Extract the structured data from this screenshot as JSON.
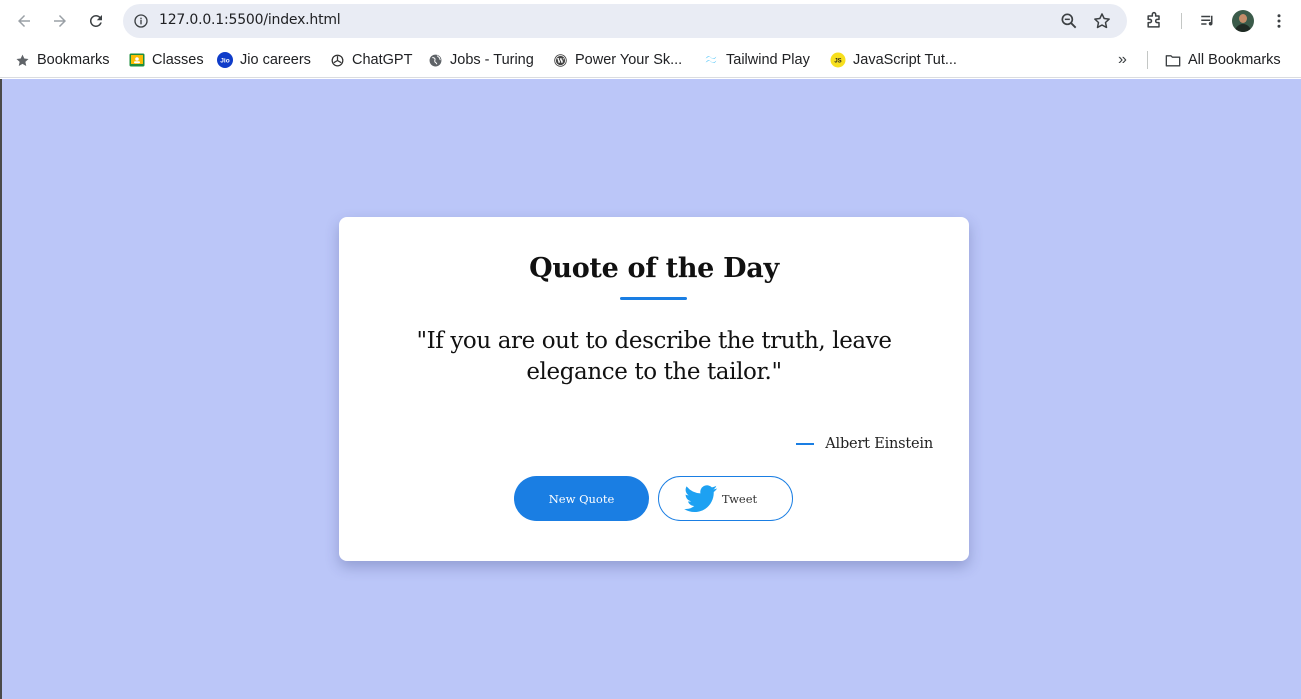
{
  "browser": {
    "url": "127.0.0.1:5500/index.html"
  },
  "bookmarks": {
    "items": [
      {
        "label": "Bookmarks",
        "icon": "star-icon"
      },
      {
        "label": "Classes",
        "icon": "classroom-icon"
      },
      {
        "label": "Jio careers",
        "icon": "jio-icon"
      },
      {
        "label": "ChatGPT",
        "icon": "openai-icon"
      },
      {
        "label": "Jobs - Turing",
        "icon": "globe-icon"
      },
      {
        "label": "Power Your Sk...",
        "icon": "wordpress-icon"
      },
      {
        "label": "Tailwind Play",
        "icon": "tailwind-icon"
      },
      {
        "label": "JavaScript Tut...",
        "icon": "js-icon"
      }
    ],
    "overflow": "»",
    "all_bookmarks": "All Bookmarks"
  },
  "page": {
    "title": "Quote of the Day",
    "quote": "\"If you are out to describe the truth, leave elegance to the tailor.\"",
    "author": "Albert Einstein",
    "new_quote_label": "New Quote",
    "tweet_label": "Tweet"
  },
  "colors": {
    "page_background": "#bbc6f8",
    "accent": "#1a7ee3",
    "twitter": "#1da1f2",
    "card": "#ffffff"
  }
}
